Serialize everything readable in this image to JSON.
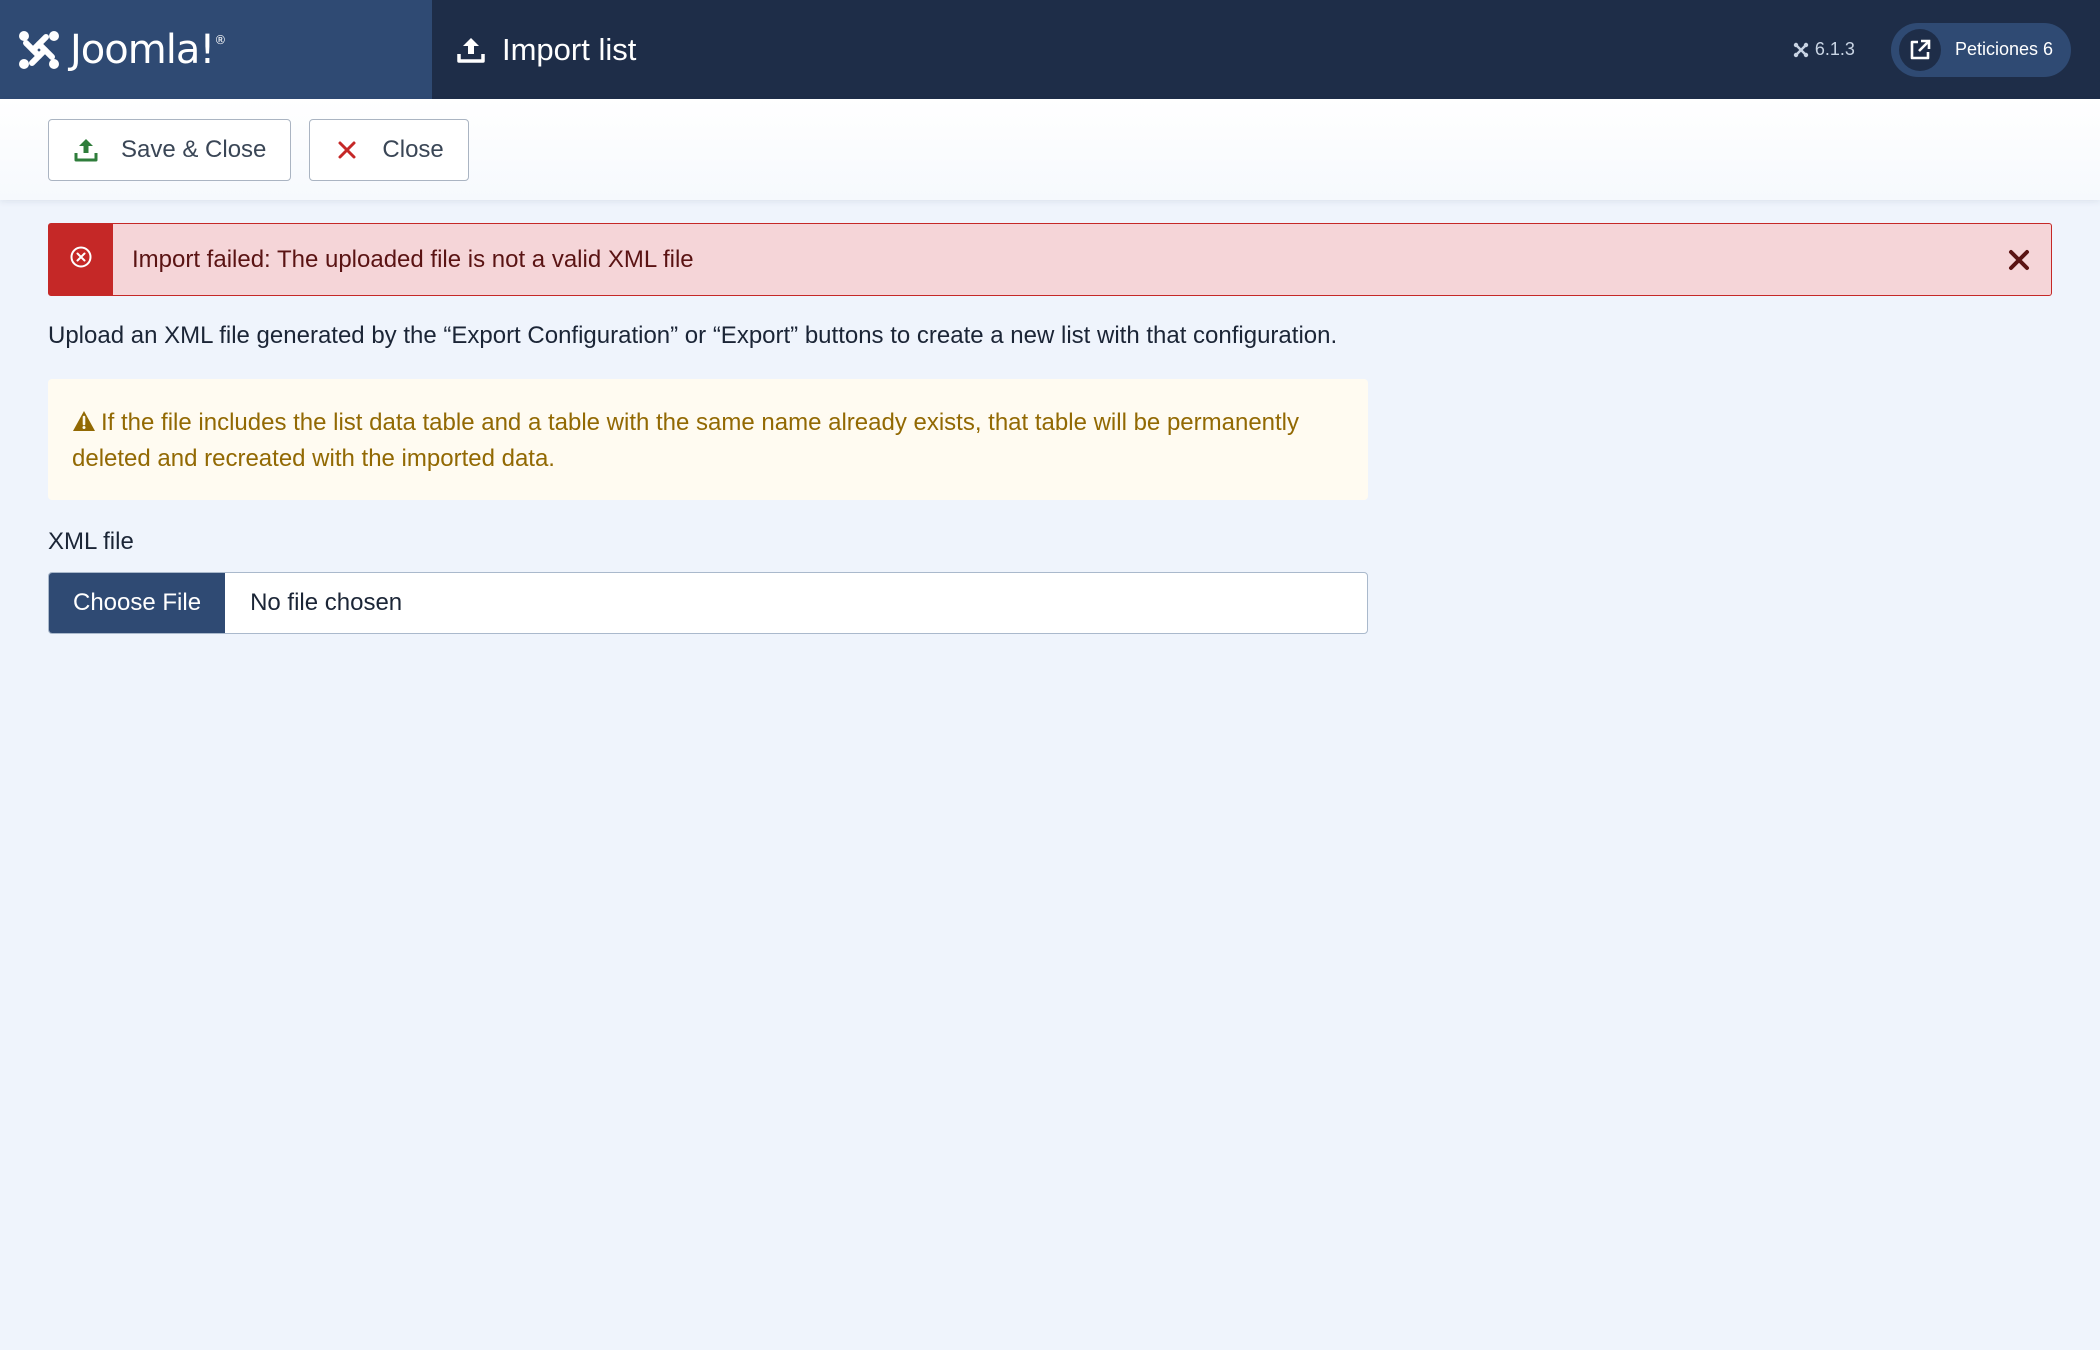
{
  "header": {
    "logo_text": "Joomla!",
    "page_title": "Import list",
    "version": "6.1.3",
    "site_button_label": "Peticiones 6"
  },
  "toolbar": {
    "save_close_label": "Save & Close",
    "close_label": "Close"
  },
  "alert": {
    "message": "Import failed: The uploaded file is not a valid XML file"
  },
  "content": {
    "intro": "Upload an XML file generated by the “Export Configuration” or “Export” buttons to create a new list with that configuration.",
    "warning": "If the file includes the list data table and a table with the same name already exists, that table will be permanently deleted and recreated with the imported data.",
    "field_label": "XML file",
    "choose_file_label": "Choose File",
    "no_file_text": "No file chosen"
  },
  "colors": {
    "header_bg": "#1e2d48",
    "logo_bg": "#2f4a73",
    "danger": "#c52827",
    "warning_text": "#926903",
    "success_icon": "#2f7d3b"
  }
}
